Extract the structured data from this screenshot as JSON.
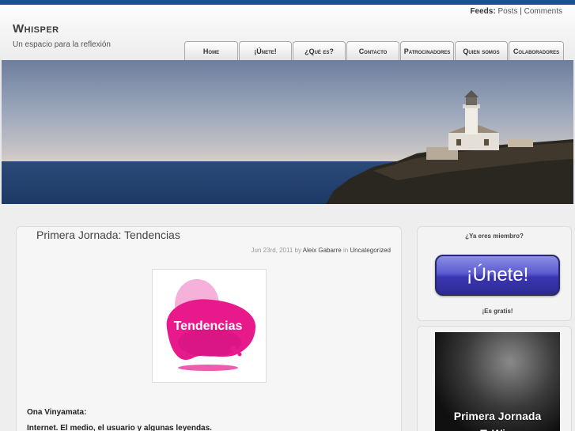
{
  "header": {
    "feeds_label": "Feeds:",
    "feeds_posts": "Posts",
    "feeds_separator": "|",
    "feeds_comments": "Comments",
    "site_title": "Whisper",
    "tagline": "Un espacio para la reflexión"
  },
  "nav": {
    "items": [
      {
        "label": "Home"
      },
      {
        "label": "¡Únete!"
      },
      {
        "label": "¿Qué es?"
      },
      {
        "label": "Contacto"
      },
      {
        "label": "Patrocinadores"
      },
      {
        "label": "Quien somos"
      },
      {
        "label": "Colaboradores"
      }
    ]
  },
  "post": {
    "title": "Primera Jornada: Tendencias",
    "date": "Jun 23rd, 2011",
    "by": "by",
    "author": "Aleix Gabarre",
    "in": "in",
    "category": "Uncategorized",
    "image_text": "Tendencias",
    "line1": "Ona Vinyamata:",
    "line2": "Internet. El medio, el usuario y algunas leyendas."
  },
  "sidebar": {
    "member_heading": "¿Ya eres miembro?",
    "join_button": "¡Únete!",
    "free_label": "¡Es gratis!",
    "promo_line1": "Primera Jornada",
    "promo_line2": "T. Wi..."
  },
  "colors": {
    "topbar": "#1e4f8a",
    "join_button": "#3a36b0",
    "tendencias_pink": "#e8198b"
  }
}
